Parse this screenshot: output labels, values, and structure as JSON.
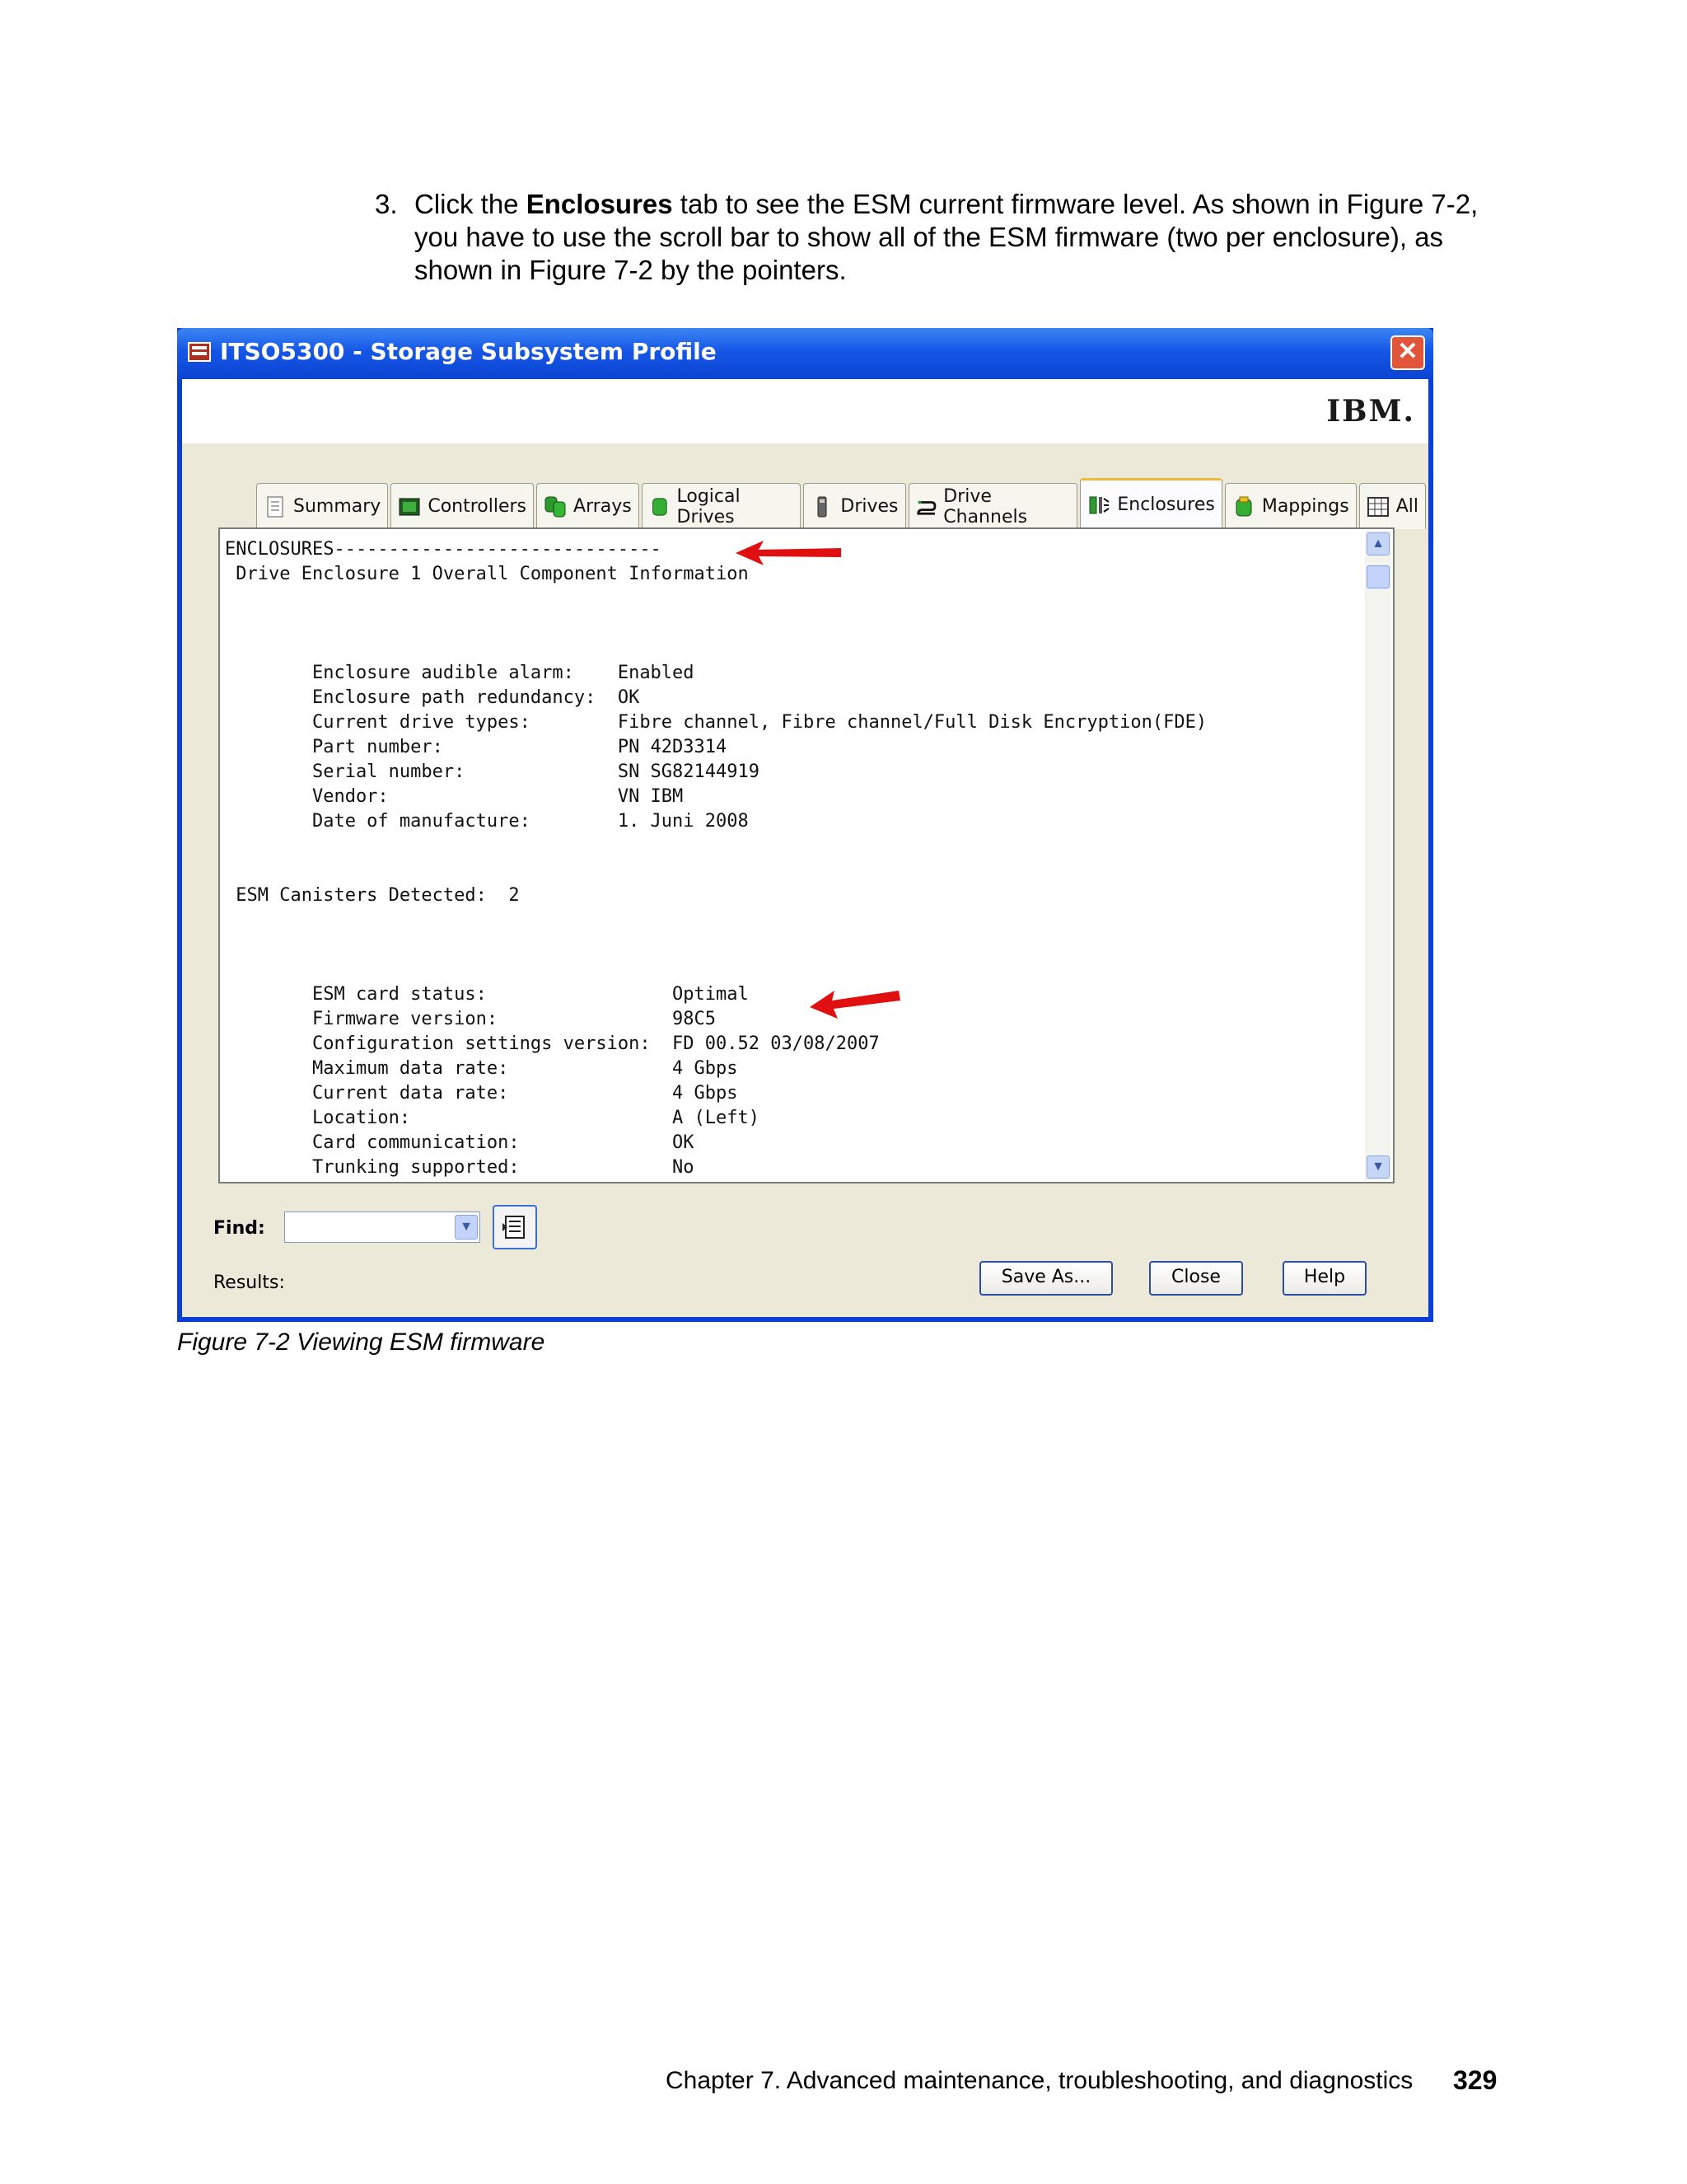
{
  "paragraph": {
    "number": "3.",
    "text_before": "Click the ",
    "bold": "Enclosures",
    "text_after": " tab to see the ESM current firmware level. As shown in Figure 7-2, you have to use the scroll bar to show all of the ESM firmware (two per enclosure), as shown in Figure 7-2 by the pointers."
  },
  "window": {
    "title": "ITSO5300 - Storage Subsystem Profile",
    "logo": "IBM."
  },
  "tabs": [
    {
      "label": "Summary",
      "icon": "summary-icon"
    },
    {
      "label": "Controllers",
      "icon": "controllers-icon"
    },
    {
      "label": "Arrays",
      "icon": "arrays-icon"
    },
    {
      "label": "Logical Drives",
      "icon": "logical-drives-icon"
    },
    {
      "label": "Drives",
      "icon": "drives-icon"
    },
    {
      "label": "Drive Channels",
      "icon": "drive-channels-icon"
    },
    {
      "label": "Enclosures",
      "icon": "enclosures-icon"
    },
    {
      "label": "Mappings",
      "icon": "mappings-icon"
    },
    {
      "label": "All",
      "icon": "all-icon"
    }
  ],
  "active_tab": "Enclosures",
  "profile_text": [
    "ENCLOSURES------------------------------",
    " Drive Enclosure 1 Overall Component Information",
    "",
    "",
    "",
    "        Enclosure audible alarm:    Enabled",
    "        Enclosure path redundancy:  OK",
    "        Current drive types:        Fibre channel, Fibre channel/Full Disk Encryption(FDE)",
    "        Part number:                PN 42D3314",
    "        Serial number:              SN SG82144919",
    "        Vendor:                     VN IBM",
    "        Date of manufacture:        1. Juni 2008",
    "",
    "",
    " ESM Canisters Detected:  2",
    "",
    "",
    "",
    "        ESM card status:                 Optimal",
    "        Firmware version:                98C5",
    "        Configuration settings version:  FD 00.52 03/08/2007",
    "        Maximum data rate:               4 Gbps",
    "        Current data rate:               4 Gbps",
    "        Location:                        A (Left)",
    "        Card communication:              OK",
    "        Trunking supported:              No"
  ],
  "find": {
    "label": "Find:",
    "value": ""
  },
  "results_label": "Results:",
  "buttons": {
    "save_as": "Save As...",
    "close": "Close",
    "help": "Help"
  },
  "caption": "Figure 7-2   Viewing ESM firmware",
  "footer": {
    "chapter": "Chapter 7. Advanced maintenance, troubleshooting, and diagnostics",
    "page": "329"
  },
  "colors": {
    "arrow": "#e01010",
    "title_bar": "#0b44d2",
    "dialog_bg": "#ece9d8"
  }
}
